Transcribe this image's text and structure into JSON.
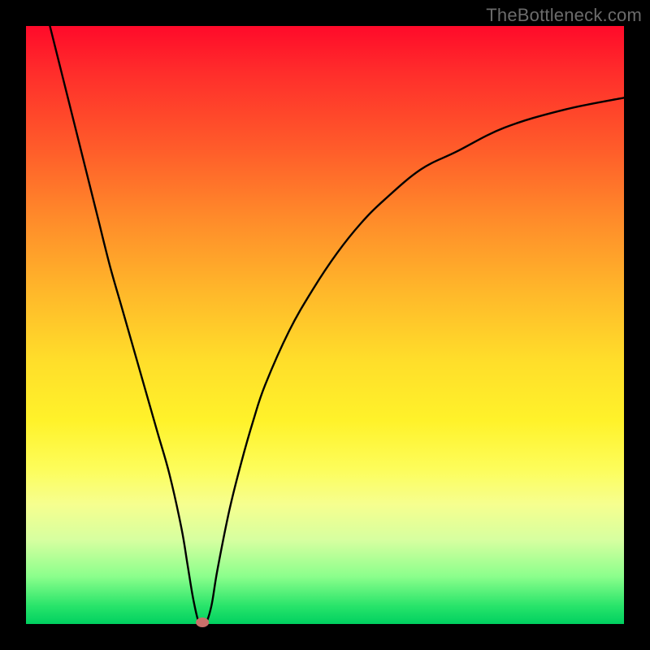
{
  "watermark": "TheBottleneck.com",
  "colors": {
    "frame": "#000000",
    "gradient_top": "#ff0a2a",
    "gradient_bottom": "#00d060",
    "curve": "#000000",
    "marker": "#c9706a"
  },
  "chart_data": {
    "type": "line",
    "title": "",
    "xlabel": "",
    "ylabel": "",
    "xlim": [
      0,
      100
    ],
    "ylim": [
      0,
      100
    ],
    "series": [
      {
        "name": "bottleneck-curve",
        "x": [
          4,
          6,
          8,
          10,
          12,
          14,
          16,
          18,
          20,
          22,
          24,
          26,
          27,
          28,
          29,
          30,
          31,
          32,
          34,
          36,
          38,
          40,
          44,
          48,
          52,
          56,
          60,
          66,
          72,
          80,
          90,
          100
        ],
        "values": [
          100,
          92,
          84,
          76,
          68,
          60,
          53,
          46,
          39,
          32,
          25,
          16,
          10,
          4,
          0,
          0,
          3,
          9,
          19,
          27,
          34,
          40,
          49,
          56,
          62,
          67,
          71,
          76,
          79,
          83,
          86,
          88
        ]
      }
    ],
    "marker": {
      "x": 29.5,
      "y": 0
    },
    "grid": false,
    "legend": false
  }
}
